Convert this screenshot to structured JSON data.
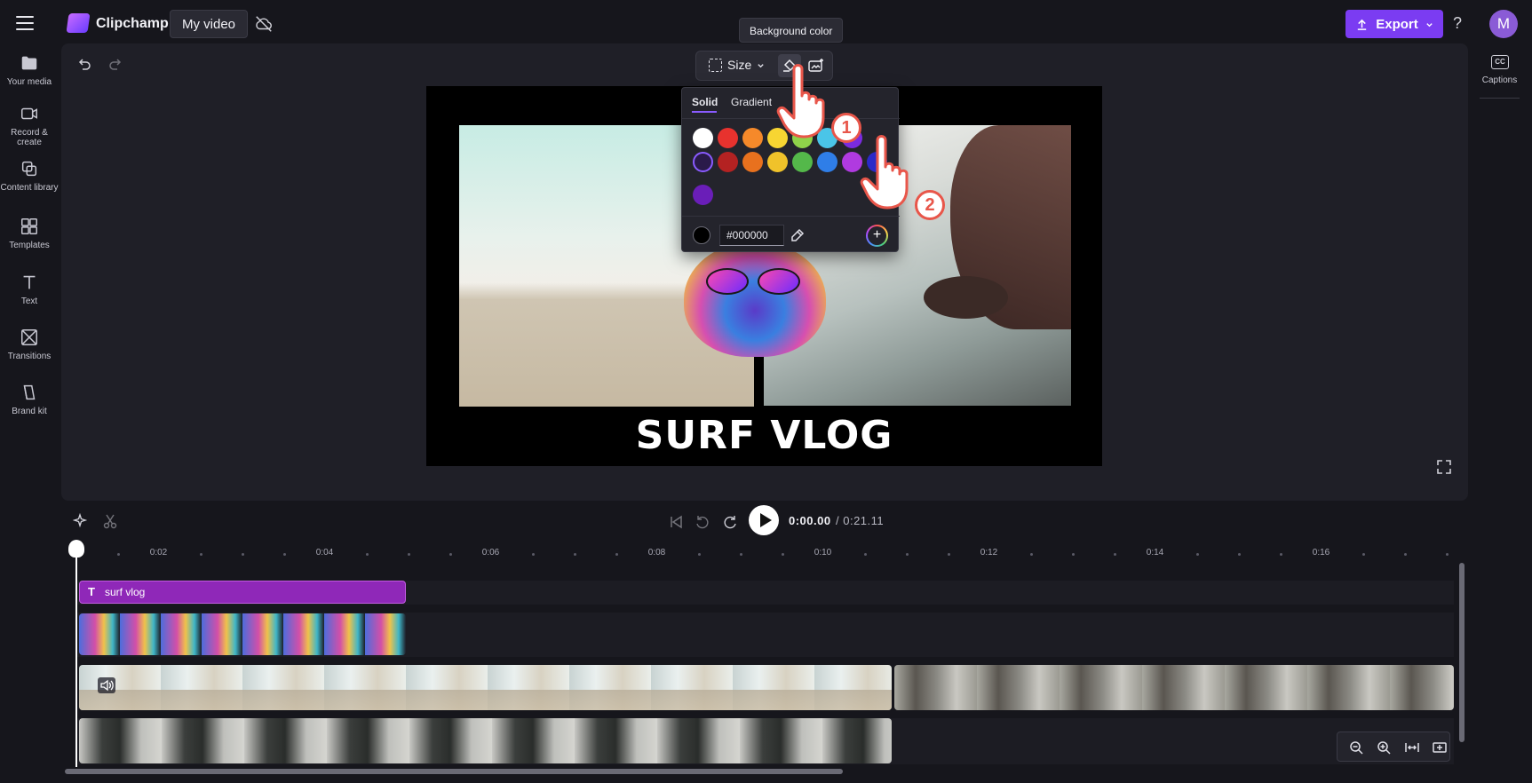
{
  "topbar": {
    "brand": "Clipchamp",
    "project_name": "My video",
    "export_label": "Export",
    "help": "?",
    "avatar_initial": "M"
  },
  "sidebar": {
    "items": [
      {
        "label": "Your media",
        "icon": "folder-icon"
      },
      {
        "label": "Record & create",
        "icon": "camera-icon"
      },
      {
        "label": "Content library",
        "icon": "library-icon"
      },
      {
        "label": "Templates",
        "icon": "templates-icon"
      },
      {
        "label": "Text",
        "icon": "text-icon"
      },
      {
        "label": "Transitions",
        "icon": "transitions-icon"
      },
      {
        "label": "Brand kit",
        "icon": "brand-kit-icon"
      }
    ]
  },
  "rightpanel": {
    "captions_icon": "CC",
    "captions_label": "Captions"
  },
  "toolbar": {
    "size_label": "Size",
    "tooltip": "Background color"
  },
  "preview": {
    "title_text": "SURF VLOG"
  },
  "color_picker": {
    "tabs": [
      "Solid",
      "Gradient"
    ],
    "active_tab": "Solid",
    "swatches_row1": [
      "#ffffff",
      "#e8322e",
      "#f5892a",
      "#f7d532",
      "#8fd24a",
      "#4ac5e8",
      "#7a2bdf"
    ],
    "swatches_row2": [
      "#2a1a4a",
      "#b42222",
      "#e8711e",
      "#f0c22a",
      "#54b84a",
      "#2f7ee8",
      "#b03ae0",
      "#2a2ac8"
    ],
    "swatches_row3": [
      "#6a1eb8"
    ],
    "hex_value": "#000000",
    "current_color": "#000000"
  },
  "steps": [
    "1",
    "2"
  ],
  "timeline": {
    "current_time": "0:00.00",
    "total_time": "/ 0:21.11",
    "ruler_labels": [
      "0:02",
      "0:04",
      "0:06",
      "0:08",
      "0:10",
      "0:12",
      "0:14",
      "0:16"
    ],
    "text_clip_label": "surf vlog"
  },
  "colors": {
    "accent": "#7b3cf2",
    "text_clip": "#8f28b8",
    "background": "#16161c",
    "panel": "#1f1f27"
  }
}
